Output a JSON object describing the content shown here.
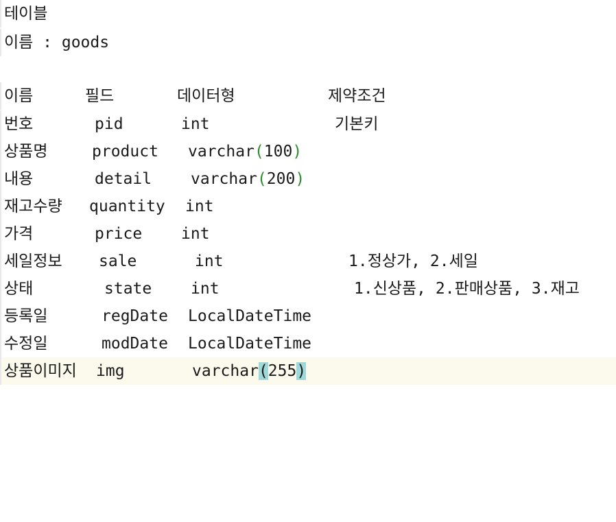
{
  "header": {
    "line1": "테이블",
    "line2": "이름 : goods"
  },
  "columns": [
    "이름",
    "필드",
    "데이터형",
    "제약조건"
  ],
  "rows": [
    {
      "name": "번호",
      "field": "pid",
      "type": "int",
      "constraint": "기본키"
    },
    {
      "name": "상품명",
      "field": "product",
      "type_base": "varchar",
      "type_open": "(",
      "type_arg": "100",
      "type_close": ")",
      "constraint": ""
    },
    {
      "name": "내용",
      "field": "detail",
      "type_base": "varchar",
      "type_open": "(",
      "type_arg": "200",
      "type_close": ")",
      "constraint": ""
    },
    {
      "name": "재고수량",
      "field": "quantity",
      "type": "int",
      "constraint": ""
    },
    {
      "name": "가격",
      "field": "price",
      "type": "int",
      "constraint": ""
    },
    {
      "name": "세일정보",
      "field": "sale",
      "type": "int",
      "constraint": "1.정상가, 2.세일"
    },
    {
      "name": "상태",
      "field": "state",
      "type": "int",
      "constraint": "1.신상품, 2.판매상품, 3.재고"
    },
    {
      "name": "등록일",
      "field": "regDate",
      "type": "LocalDateTime",
      "constraint": ""
    },
    {
      "name": "수정일",
      "field": "modDate",
      "type": "LocalDateTime",
      "constraint": ""
    },
    {
      "name": "상품이미지",
      "field": "img",
      "type_base": "varchar",
      "type_open": "(",
      "type_arg": "255",
      "type_close": ")",
      "constraint": ""
    }
  ],
  "colors": {
    "current_line": "#fcfaed",
    "paren": "#2e8b2e",
    "brace_match": "#9fd8d8"
  }
}
